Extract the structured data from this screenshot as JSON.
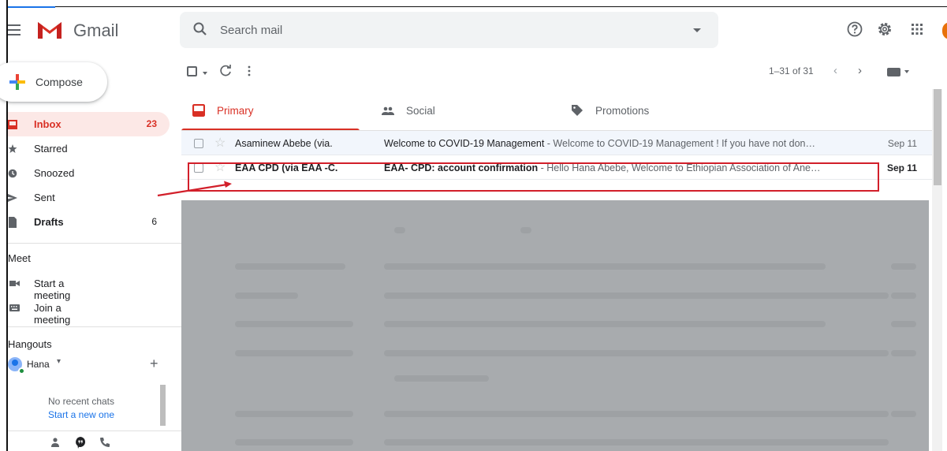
{
  "app": {
    "name": "Gmail"
  },
  "search": {
    "placeholder": "Search mail"
  },
  "header_icons": [
    "help-icon",
    "settings-icon",
    "apps-icon"
  ],
  "sidebar": {
    "compose": "Compose",
    "items": [
      {
        "label": "Inbox",
        "count": "23",
        "icon": "inbox-icon",
        "active": true
      },
      {
        "label": "Starred",
        "count": "",
        "icon": "star-icon"
      },
      {
        "label": "Snoozed",
        "count": "",
        "icon": "clock-icon"
      },
      {
        "label": "Sent",
        "count": "",
        "icon": "send-icon"
      },
      {
        "label": "Drafts",
        "count": "6",
        "icon": "draft-icon",
        "bold": true
      }
    ],
    "meet": {
      "title": "Meet",
      "items": [
        {
          "label": "Start a meeting",
          "icon": "video-icon"
        },
        {
          "label": "Join a meeting",
          "icon": "keyboard-icon"
        }
      ]
    },
    "hangouts": {
      "title": "Hangouts",
      "user": "Hana",
      "user_caret": "▾",
      "add": "+",
      "no_recent": "No recent chats",
      "start_new": "Start a new one"
    }
  },
  "toolbar": {
    "pager": "1–31 of 31",
    "prev": "‹",
    "next": "›"
  },
  "tabs": [
    {
      "label": "Primary",
      "icon": "inbox-icon",
      "active": true
    },
    {
      "label": "Social",
      "icon": "people-icon"
    },
    {
      "label": "Promotions",
      "icon": "tag-icon"
    }
  ],
  "emails": [
    {
      "sender": "Asaminew Abebe (via.",
      "subject": "Welcome to COVID-19 Management",
      "snippet": " - Welcome to COVID-19 Management ! If you have not don…",
      "date": "Sep 11",
      "unread": false
    },
    {
      "sender": "EAA CPD (via EAA -C.",
      "subject": "EAA- CPD: account confirmation",
      "snippet": " - Hello Hana Abebe, Welcome to Ethiopian Association of Ane…",
      "date": "Sep 11",
      "unread": true
    }
  ],
  "colors": {
    "accent": "#d93025",
    "highlight_box": "#d21f2a",
    "overlay": "#a8abae",
    "unread_bg": "#ffffff",
    "read_bg": "#f2f6fc"
  }
}
